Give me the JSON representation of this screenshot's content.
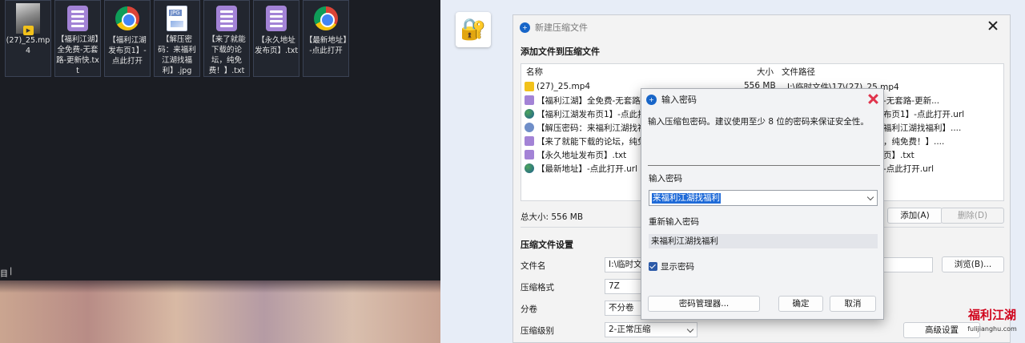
{
  "desktop": {
    "icons": [
      {
        "label": "(27)_25.mp4",
        "kind": "mp4"
      },
      {
        "label": "【福利江湖】全免费-无套路-更新快.txt",
        "kind": "txt"
      },
      {
        "label": "【福利江湖发布页1】-点此打开",
        "kind": "url"
      },
      {
        "label": "【解压密码：来福利江湖找福利】.jpg",
        "kind": "jpg",
        "badge": "JPG"
      },
      {
        "label": "【来了就能下载的论坛，纯免费！】.txt",
        "kind": "txt"
      },
      {
        "label": "【永久地址发布页】.txt",
        "kind": "txt"
      },
      {
        "label": "【最新地址】-点此打开",
        "kind": "url"
      }
    ],
    "taskbar_text": "目",
    "cursor": "|"
  },
  "main_window": {
    "title": "新建压缩文件",
    "app_icon": "+",
    "add_files_heading": "添加文件到压缩文件",
    "columns": {
      "name": "名称",
      "size": "大小",
      "path": "文件路径"
    },
    "files": [
      {
        "name": "(27)_25.mp4",
        "size": "556 MB",
        "path": "I:\\临时文件\\17\\(27)_25.mp4",
        "kind": "mp4"
      },
      {
        "name": "【福利江湖】全免费-无套路-更",
        "path": "-无套路-更新...",
        "kind": "txt"
      },
      {
        "name": "【福利江湖发布页1】-点此打开",
        "path": "布页1】-点此打开.url",
        "kind": "url"
      },
      {
        "name": "【解压密码：来福利江湖找福利",
        "path": "福利江湖找福利】....",
        "kind": "jpg"
      },
      {
        "name": "【来了就能下载的论坛，纯免费",
        "path": "，纯免费！】....",
        "kind": "txt"
      },
      {
        "name": "【永久地址发布页】.txt",
        "path": "页】.txt",
        "kind": "txt"
      },
      {
        "name": "【最新地址】-点此打开.url",
        "path": "-点此打开.url",
        "kind": "url"
      }
    ],
    "total": "总大小: 556 MB",
    "add_button": "添加(A)",
    "delete_button": "删除(D)",
    "settings_heading": "压缩文件设置",
    "filename_label": "文件名",
    "filename_value": "I:\\临时文件",
    "browse_button": "浏览(B)...",
    "format_label": "压缩格式",
    "format_value": "7Z",
    "split_label": "分卷",
    "split_value": "不分卷",
    "level_label": "压缩级别",
    "level_value": "2-正常压缩",
    "advanced_button": "高级设置"
  },
  "password_dialog": {
    "title": "输入密码",
    "description": "输入压缩包密码。建议使用至少 8 位的密码来保证安全性。",
    "password_label": "输入密码",
    "password_value": "来福利江湖找福利",
    "confirm_label": "重新输入密码",
    "confirm_value": "来福利江湖找福利",
    "show_password_label": "显示密码",
    "show_password_checked": true,
    "manager_button": "密码管理器...",
    "ok_button": "确定",
    "cancel_button": "取消"
  },
  "watermark": {
    "title": "福利江湖",
    "url": "fulijianghu.com"
  },
  "colors": {
    "accent": "#1765c8",
    "close_red": "#e0344c",
    "selection": "#1e6ad8",
    "txt_icon": "#a383d6",
    "mp4_icon": "#f2c21b"
  }
}
